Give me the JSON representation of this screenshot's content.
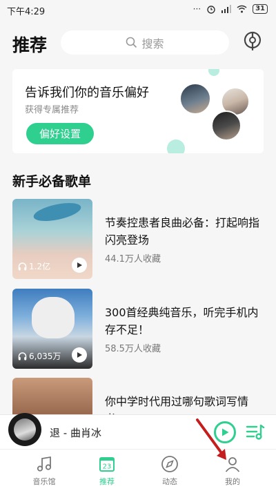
{
  "status_bar": {
    "time": "下午4:29",
    "battery": "31"
  },
  "header": {
    "title": "推荐",
    "search_placeholder": "搜索"
  },
  "preference_card": {
    "title": "告诉我们你的音乐偏好",
    "subtitle": "获得专属推荐",
    "button_label": "偏好设置"
  },
  "section": {
    "title": "新手必备歌单"
  },
  "playlists": [
    {
      "title": "节奏控患者良曲必备：打起响指闪亮登场",
      "meta": "44.1万人收藏",
      "plays": "1.2亿"
    },
    {
      "title": "300首经典纯音乐，听完手机内存不足！",
      "meta": "58.5万人收藏",
      "plays": "6,035万"
    },
    {
      "title": "你中学时代用过哪句歌词写情书?",
      "meta": "",
      "plays": ""
    }
  ],
  "player": {
    "song": "退 - 曲肖冰"
  },
  "tabs": [
    {
      "label": "音乐馆",
      "icon": "music-note-icon"
    },
    {
      "label": "推荐",
      "icon": "calendar-icon",
      "badge": "23"
    },
    {
      "label": "动态",
      "icon": "compass-icon"
    },
    {
      "label": "我的",
      "icon": "person-icon"
    }
  ],
  "colors": {
    "accent": "#2fcf8f",
    "background": "#f6f6f6"
  }
}
